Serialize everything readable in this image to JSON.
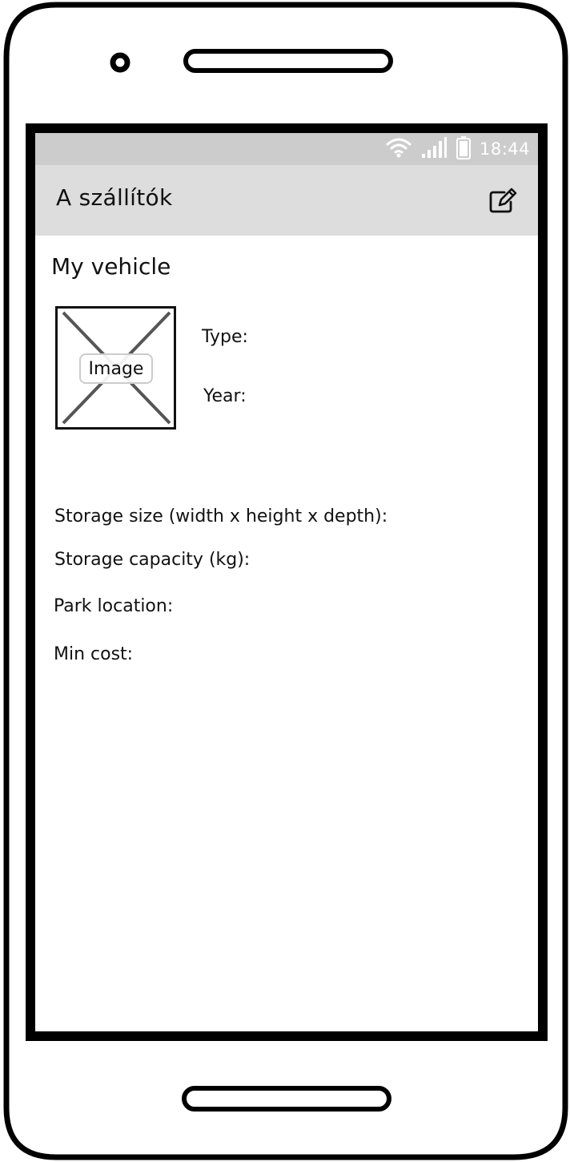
{
  "status_bar": {
    "time": "18:44",
    "icons": [
      "wifi-icon",
      "signal-icon",
      "battery-icon"
    ]
  },
  "app_bar": {
    "title": "A szállítók",
    "action_icon": "edit-icon"
  },
  "content": {
    "title": "My vehicle",
    "image_placeholder_label": "Image",
    "type_label": "Type:",
    "year_label": "Year:",
    "storage_size_label": "Storage size (width x height x depth):",
    "storage_capacity_label": "Storage capacity (kg):",
    "park_location_label": "Park location:",
    "min_cost_label": "Min cost:"
  },
  "colors": {
    "status_bar_bg": "#cccccc",
    "app_bar_bg": "#dddddd",
    "frame": "#000000"
  }
}
